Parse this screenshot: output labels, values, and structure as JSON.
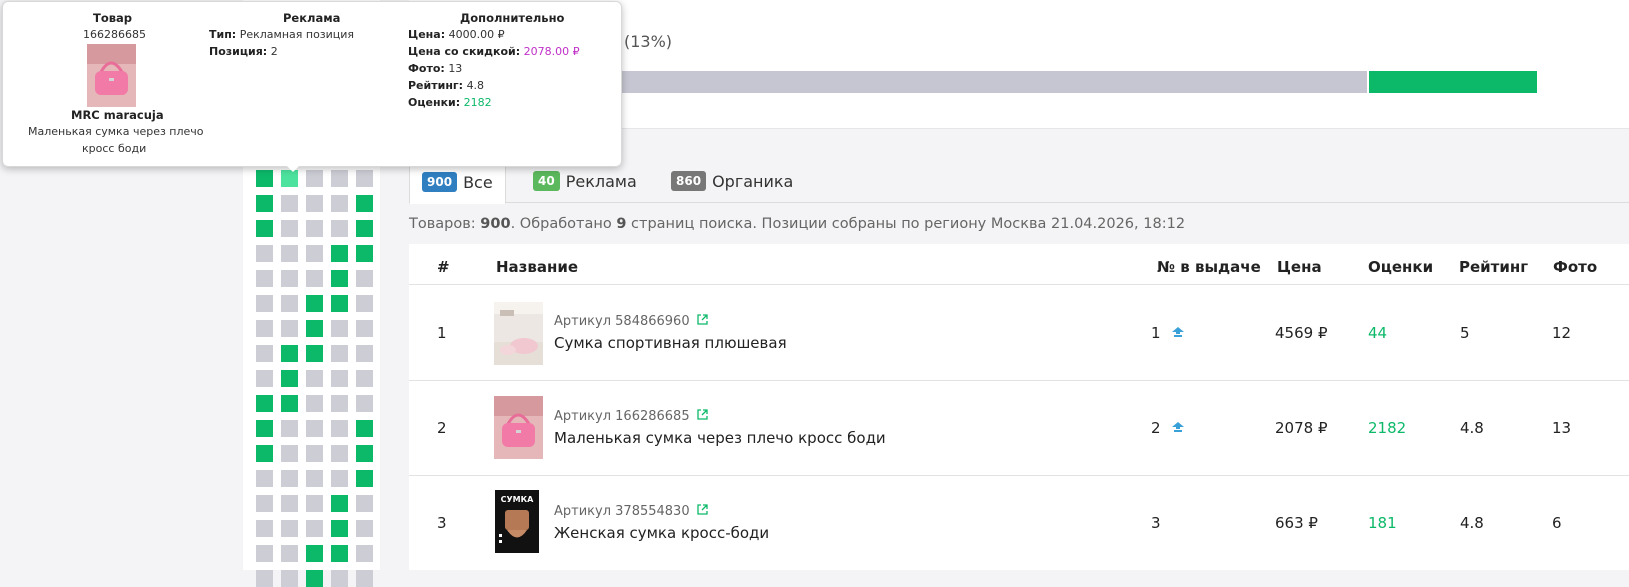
{
  "summary": {
    "percent_text": "(13%)",
    "organic_share": 0.87,
    "ads_share": 0.13
  },
  "tabs": [
    {
      "count": "900",
      "label": "Все",
      "color": "#2f7fc1"
    },
    {
      "count": "40",
      "label": "Реклама",
      "color": "#5cb85c"
    },
    {
      "count": "860",
      "label": "Органика",
      "color": "#777777"
    }
  ],
  "status": {
    "prefix": "Товаров: ",
    "count": "900",
    "middle": ". Обработано ",
    "pages": "9",
    "suffix": " страниц поиска. Позиции собраны по региону Москва 21.04.2026, 18:12"
  },
  "table": {
    "headers": [
      "#",
      "Название",
      "№ в выдаче",
      "Цена",
      "Оценки",
      "Рейтинг",
      "Фото"
    ],
    "rows": [
      {
        "num": "1",
        "article": "Артикул 584866960",
        "name": "Сумка спортивная плюшевая",
        "position": "1",
        "price": "4569 ₽",
        "reviews": "44",
        "rating": "5",
        "photos": "12"
      },
      {
        "num": "2",
        "article": "Артикул 166286685",
        "name": "Маленькая сумка через плечо кросс боди",
        "position": "2",
        "price": "2078 ₽",
        "reviews": "2182",
        "rating": "4.8",
        "photos": "13"
      },
      {
        "num": "3",
        "article": "Артикул 378554830",
        "name": "Женская сумка кросс-боди",
        "position": "3",
        "price": "663 ₽",
        "reviews": "181",
        "rating": "4.8",
        "photos": "6"
      }
    ]
  },
  "thumb3_text": "СУМКА",
  "tooltip": {
    "h_product": "Товар",
    "h_ad": "Реклама",
    "h_extra": "Дополнительно",
    "product_id": "166286685",
    "brand": "MRC maracuja",
    "product_name_1": "Маленькая сумка через плечо",
    "product_name_2": "кросс боди",
    "type_label": "Тип:",
    "type_value": "Рекламная позиция",
    "position_label": "Позиция:",
    "position_value": "2",
    "price_label": "Цена:",
    "price_value": "4000.00 ₽",
    "discount_label": "Цена со скидкой:",
    "discount_value": "2078.00 ₽",
    "photo_label": "Фото:",
    "photo_value": "13",
    "rating_label": "Рейтинг:",
    "rating_value": "4.8",
    "reviews_label": "Оценки:",
    "reviews_value": "2182"
  },
  "grid_pattern": [
    "GHOOO",
    "GOOOG",
    "GOOOG",
    "OOOGG",
    "OOOGO",
    "OOGGO",
    "OOGOO",
    "OGGOO",
    "OGOOO",
    "GGOOO",
    "GOOOG",
    "GOOOG",
    "OOOOG",
    "OOOGO",
    "OOOGO",
    "OOGGO",
    "OOGOO"
  ]
}
